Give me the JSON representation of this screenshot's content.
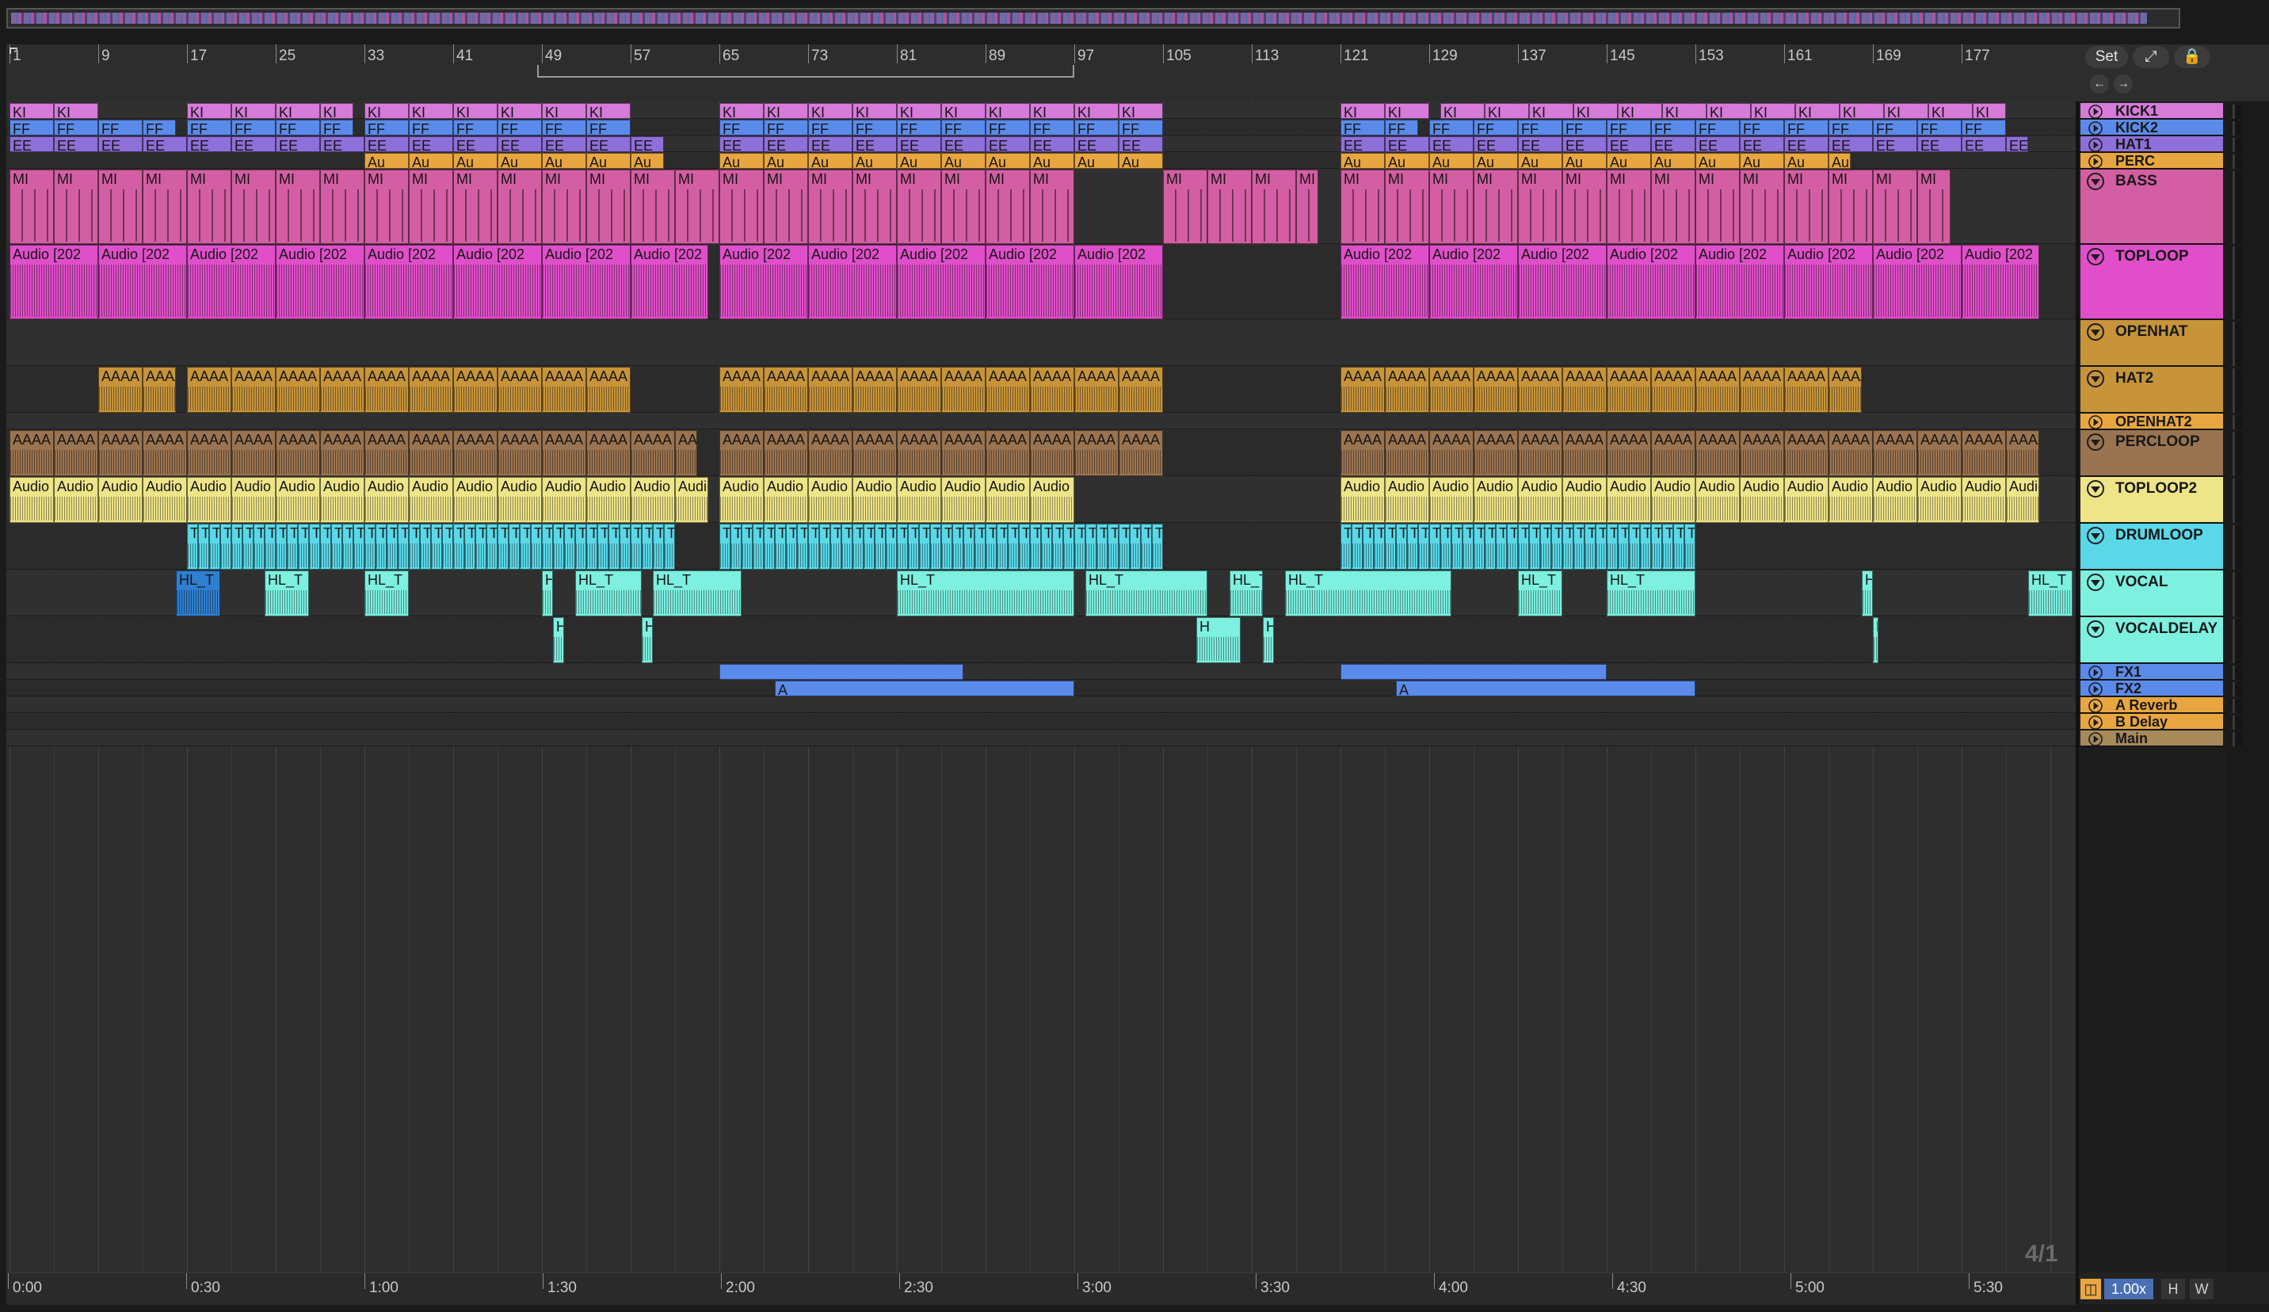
{
  "ruler": {
    "bars": [
      "1",
      "9",
      "17",
      "25",
      "33",
      "41",
      "49",
      "57",
      "65",
      "73",
      "81",
      "89",
      "97",
      "105",
      "113",
      "121",
      "129",
      "137",
      "145",
      "153",
      "161",
      "169",
      "177"
    ]
  },
  "time_ruler": {
    "labels": [
      "0:00",
      "0:30",
      "1:00",
      "1:30",
      "2:00",
      "2:30",
      "3:00",
      "3:30",
      "4:00",
      "4:30",
      "5:00",
      "5:30"
    ]
  },
  "controls": {
    "set_label": "Set",
    "expand_icon": "expand-icon",
    "lock_icon": "lock-icon",
    "back_icon": "arrow-left-icon",
    "forward_icon": "arrow-right-icon",
    "zoom_grid": "4/1",
    "tempo_icon": "metronome-icon",
    "zoom_factor": "1.00x",
    "h_label": "H",
    "w_label": "W"
  },
  "tracks": [
    {
      "name": "KICK1",
      "color": "#d67bd9",
      "open": false,
      "clip_label": "KI",
      "kind": "midi"
    },
    {
      "name": "KICK2",
      "color": "#5b8bea",
      "open": false,
      "clip_label": "FF",
      "kind": "midi"
    },
    {
      "name": "HAT1",
      "color": "#8f6fd9",
      "open": false,
      "clip_label": "EE",
      "kind": "midi"
    },
    {
      "name": "PERC",
      "color": "#e8a640",
      "open": false,
      "clip_label": "Au",
      "kind": "audio"
    },
    {
      "name": "BASS",
      "color": "#d45ea3",
      "open": true,
      "clip_label": "MI",
      "kind": "midi"
    },
    {
      "name": "TOPLOOP",
      "color": "#e04fc9",
      "open": true,
      "clip_label": "Audio [202",
      "kind": "audio"
    },
    {
      "name": "OPENHAT",
      "color": "#c7943a",
      "open": true,
      "clip_label": "",
      "kind": "audio"
    },
    {
      "name": "HAT2",
      "color": "#c7943a",
      "open": true,
      "clip_label": "AAAA",
      "kind": "audio"
    },
    {
      "name": "OPENHAT2",
      "color": "#e8a640",
      "open": false,
      "clip_label": "",
      "kind": "audio"
    },
    {
      "name": "PERCLOOP",
      "color": "#9a7450",
      "open": true,
      "clip_label": "AAAA",
      "kind": "audio"
    },
    {
      "name": "TOPLOOP2",
      "color": "#eee488",
      "open": true,
      "clip_label": "Audio [202",
      "kind": "audio"
    },
    {
      "name": "DRUMLOOP",
      "color": "#5ad8e8",
      "open": true,
      "clip_label": "TC",
      "kind": "audio"
    },
    {
      "name": "VOCAL",
      "color": "#7df0e0",
      "open": true,
      "clip_label": "HL_T",
      "kind": "audio"
    },
    {
      "name": "VOCALDELAY",
      "color": "#7df0e0",
      "open": true,
      "clip_label": "H",
      "kind": "audio"
    },
    {
      "name": "FX1",
      "color": "#5b8bea",
      "open": false,
      "clip_label": "",
      "kind": "audio"
    },
    {
      "name": "FX2",
      "color": "#5b8bea",
      "open": false,
      "clip_label": "A",
      "kind": "audio"
    },
    {
      "name": "A Reverb",
      "color": "#e8a640",
      "open": false,
      "clip_label": "",
      "kind": "return"
    },
    {
      "name": "B Delay",
      "color": "#e8a640",
      "open": false,
      "clip_label": "",
      "kind": "return"
    },
    {
      "name": "Main",
      "color": "#a8895a",
      "open": false,
      "clip_label": "",
      "kind": "main"
    }
  ]
}
